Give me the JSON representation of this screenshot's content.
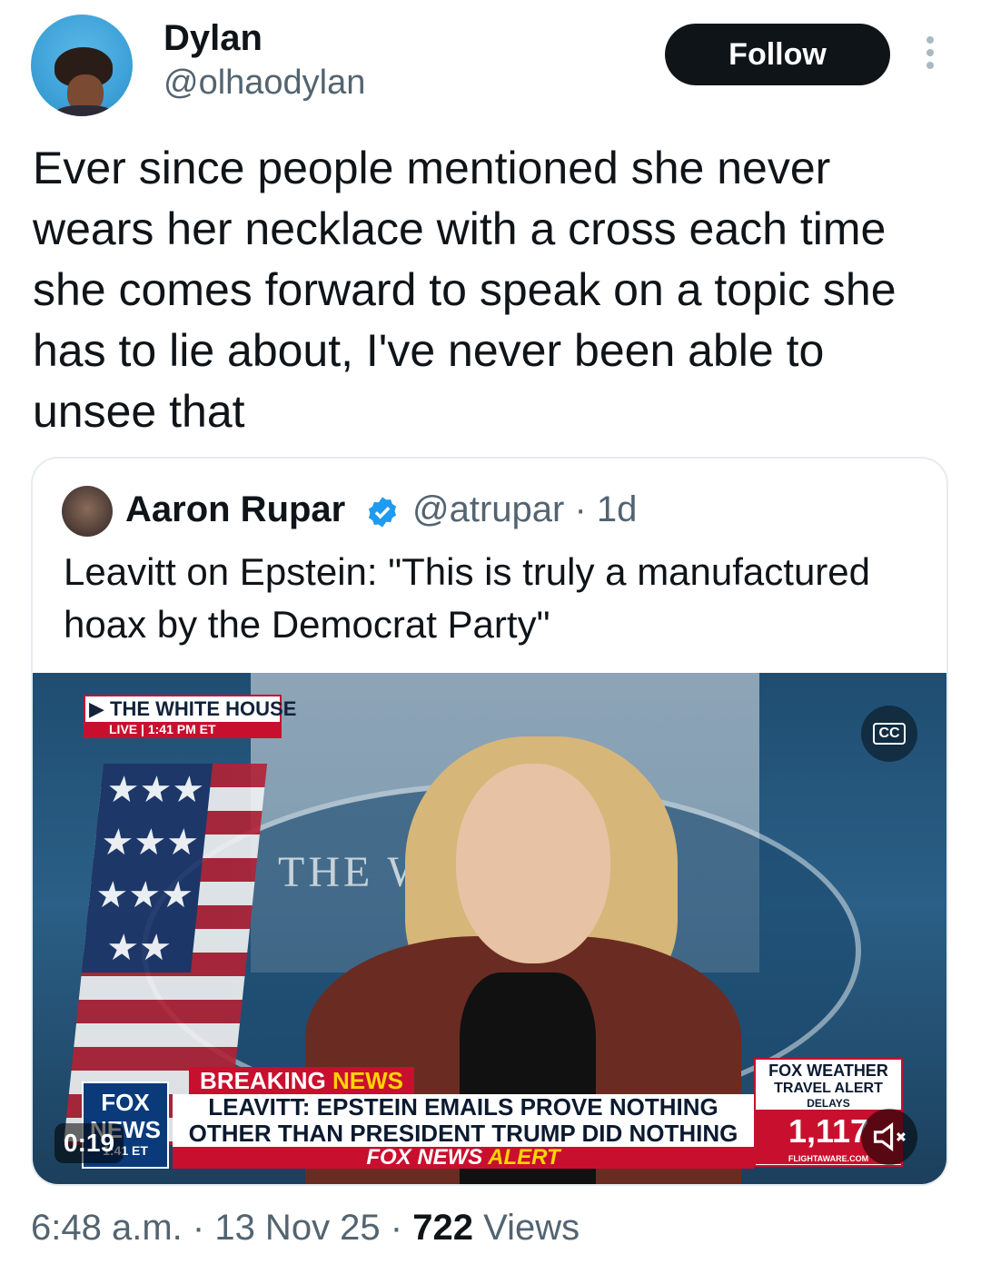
{
  "tweet": {
    "author_name": "Dylan",
    "author_handle": "@olhaodylan",
    "follow_label": "Follow",
    "more_icon": "more-vertical-icon",
    "text": "Ever since people mentioned she never\nwears her necklace with a cross each time\nshe comes forward to speak on a topic she\nhas to lie about, I've never been able to\nunsee that",
    "time": "6:48 a.m.",
    "date": "13 Nov 25",
    "views_count": "722",
    "views_label": "Views"
  },
  "quote": {
    "author_name": "Aaron Rupar",
    "verified_icon": "verified-badge-icon",
    "author_handle": "@atrupar",
    "age": "1d",
    "text": "Leavitt on Epstein: \"This is truly a manufactured\nhoax by the Democrat Party\"",
    "video": {
      "live_title": "THE WHITE HOUSE",
      "live_label": "LIVE",
      "live_time": "1:41 PM ET",
      "backdrop_text": "THE W        OUSE",
      "breaking_label_1": "BREAKING",
      "breaking_label_2": "NEWS",
      "headline": "LEAVITT: EPSTEIN EMAILS PROVE NOTHING\nOTHER THAN PRESIDENT TRUMP DID NOTHING WRONG",
      "alert_label_1": "FOX NEWS",
      "alert_label_2": "ALERT",
      "logo_text": "FOX NEWS",
      "logo_time": "1:41 ET",
      "weather_brand": "FOX WEATHER",
      "weather_title": "TRAVEL ALERT",
      "weather_sub": "DELAYS",
      "weather_count": "1,117",
      "weather_source": "FLIGHTAWARE.COM",
      "elapsed": "0:19",
      "cc_label": "CC"
    }
  }
}
